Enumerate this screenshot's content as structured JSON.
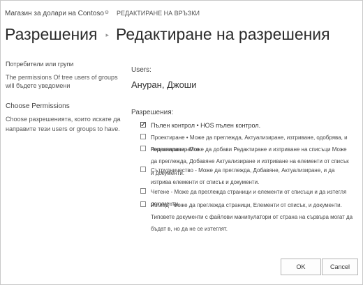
{
  "header": {
    "site_link": "Магазин за долари на Contoso",
    "edit_links": "РЕДАКТИРАНЕ НА ВРЪЗКИ"
  },
  "breadcrumb": {
    "root": "Разрешения",
    "current": "Редактиране на разрешения"
  },
  "left_panel": {
    "section1_title": "Потребители или групи",
    "section1_desc": "The permissions Of tree users of groups will бъдете уведомени",
    "section2_title": "Choose Permissions",
    "section2_desc": "Choose разрешенията, които искате да направите тези users or groups to have."
  },
  "users": {
    "label": "Users:",
    "value": "Ануран, Джоши"
  },
  "permissions": {
    "label": "Разрешения:",
    "items": [
      {
        "text": "Пълен контрол • HOS пълен контрол.",
        "checked": true
      },
      {
        "text": "Проектиране • Може да преглежда, Актуализиране, изтриване, одобрява, и персонализирайте.",
        "checked": false
      },
      {
        "text": "Редактиране - Може да добави Редактиране и изтриване на списъци Може да преглежда, Добавяне Актуализиране и изтриване на елементи от списък и документи.",
        "checked": false
      },
      {
        "text": "Сътрудничество - Може да преглежда, Добавяне, Актуализиране, и да изтрива елементи от списък и документи.",
        "checked": false
      },
      {
        "text": "Четене - Може да преглежда страници и елементи от списъци и да изтегля документи.",
        "checked": false
      },
      {
        "text": "Изглед - може да преглежда страници, Елементи от списък, и документи. Типовете документи с файлови манипулатори от страна на сървъра могат да бъдат в, но да не се изтеглят.",
        "checked": false
      }
    ]
  },
  "buttons": {
    "ok": "OK",
    "cancel": "Cancel"
  }
}
